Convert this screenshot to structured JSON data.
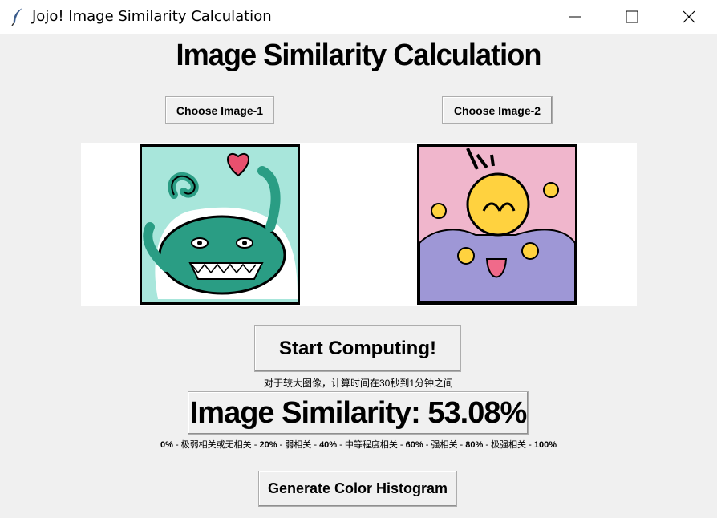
{
  "window": {
    "title": "Jojo! Image Similarity Calculation",
    "icon": "feather-icon",
    "controls": [
      "minimize-icon",
      "maximize-icon",
      "close-icon"
    ]
  },
  "heading": "Image Similarity Calculation",
  "choose_image_1_label": "Choose Image-1",
  "choose_image_2_label": "Choose Image-2",
  "images": [
    {
      "description_icon": "octopus-green-image",
      "background": "#a8e6db"
    },
    {
      "description_icon": "octopus-purple-image",
      "background": "#f0b6cc"
    }
  ],
  "start_button_label": "Start Computing!",
  "note": "对于较大图像，计算时间在30秒到1分钟之间",
  "result_label": "Image Similarity: 53.08%",
  "scale": {
    "p0": "0%",
    "c1": " - 极弱相关或无相关 - ",
    "p20": "20%",
    "c2": " - 弱相关 - ",
    "p40": "40%",
    "c3": " - 中等程度相关 - ",
    "p60": "60%",
    "c4": " - 强相关 - ",
    "p80": "80%",
    "c5": " - 极强相关 - ",
    "p100": "100%"
  },
  "histogram_button_label": "Generate Color Histogram"
}
